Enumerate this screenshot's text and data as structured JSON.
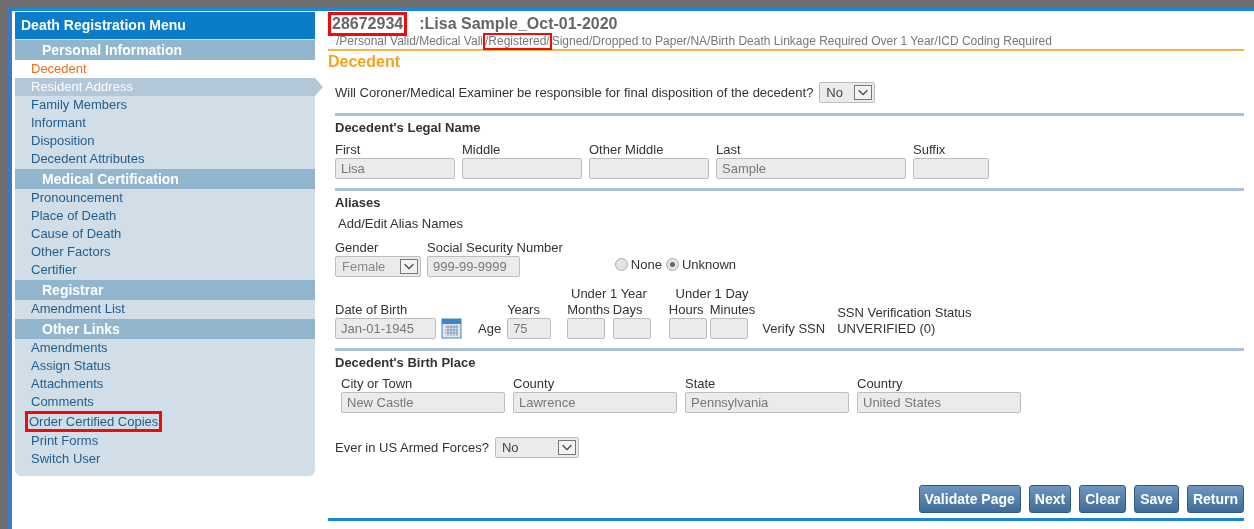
{
  "sidebar": {
    "title": "Death Registration Menu",
    "sections": [
      {
        "title": "Personal Information",
        "items": [
          {
            "label": "Decedent",
            "selected": true,
            "hovered": false,
            "highlighted": false
          },
          {
            "label": "Resident Address",
            "selected": false,
            "hovered": true,
            "highlighted": false
          },
          {
            "label": "Family Members",
            "selected": false,
            "hovered": false,
            "highlighted": false
          },
          {
            "label": "Informant",
            "selected": false,
            "hovered": false,
            "highlighted": false
          },
          {
            "label": "Disposition",
            "selected": false,
            "hovered": false,
            "highlighted": false
          },
          {
            "label": "Decedent Attributes",
            "selected": false,
            "hovered": false,
            "highlighted": false
          }
        ]
      },
      {
        "title": "Medical Certification",
        "items": [
          {
            "label": "Pronouncement",
            "selected": false,
            "hovered": false,
            "highlighted": false
          },
          {
            "label": "Place of Death",
            "selected": false,
            "hovered": false,
            "highlighted": false
          },
          {
            "label": "Cause of Death",
            "selected": false,
            "hovered": false,
            "highlighted": false
          },
          {
            "label": "Other Factors",
            "selected": false,
            "hovered": false,
            "highlighted": false
          },
          {
            "label": "Certifier",
            "selected": false,
            "hovered": false,
            "highlighted": false
          }
        ]
      },
      {
        "title": "Registrar",
        "items": [
          {
            "label": "Amendment List",
            "selected": false,
            "hovered": false,
            "highlighted": false
          }
        ]
      },
      {
        "title": "Other Links",
        "items": [
          {
            "label": "Amendments",
            "selected": false,
            "hovered": false,
            "highlighted": false
          },
          {
            "label": "Assign Status",
            "selected": false,
            "hovered": false,
            "highlighted": false
          },
          {
            "label": "Attachments",
            "selected": false,
            "hovered": false,
            "highlighted": false
          },
          {
            "label": "Comments",
            "selected": false,
            "hovered": false,
            "highlighted": false
          },
          {
            "label": "Order Certified Copies",
            "selected": false,
            "hovered": false,
            "highlighted": true
          },
          {
            "label": "Print Forms",
            "selected": false,
            "hovered": false,
            "highlighted": false
          },
          {
            "label": "Switch User",
            "selected": false,
            "hovered": false,
            "highlighted": false
          }
        ]
      }
    ]
  },
  "record": {
    "id": "28672934",
    "id_highlighted": true,
    "name": ":Lisa Sample_Oct-01-2020",
    "status": [
      {
        "text": "/Personal Valid/Medical Vali",
        "highlighted": false
      },
      {
        "text": "/Registered/",
        "highlighted": true
      },
      {
        "text": "Signed/Dropped to Paper/NA/Birth Death Linkage Required Over 1 Year/ICD Coding Required",
        "highlighted": false
      }
    ]
  },
  "page_title": "Decedent",
  "coroner": {
    "question": "Will Coroner/Medical Examiner be responsible for final disposition of the decedent?",
    "value": "No"
  },
  "legal_name": {
    "title": "Decedent's Legal Name",
    "fields": [
      {
        "label": "First",
        "value": "Lisa"
      },
      {
        "label": "Middle"
      },
      {
        "label": "Other Middle"
      },
      {
        "label": "Last",
        "value": "Sample"
      },
      {
        "label": "Suffix"
      }
    ]
  },
  "aliases": {
    "title": "Aliases",
    "link": "Add/Edit Alias Names",
    "gender": {
      "label": "Gender",
      "value": "Female"
    },
    "ssn": {
      "label": "Social Security Number",
      "value": "999-99-9999"
    },
    "ssn_options": [
      {
        "label": "None",
        "selected": false
      },
      {
        "label": "Unknown",
        "selected": true
      }
    ],
    "dob": {
      "label": "Date of Birth",
      "value": "Jan-01-1945"
    },
    "age_label": "Age",
    "years": {
      "label": "Years",
      "value": "75"
    },
    "under_year": {
      "label": "Under 1 Year",
      "fields": [
        {
          "label": "Months"
        },
        {
          "label": "Days"
        }
      ]
    },
    "under_day": {
      "label": "Under 1 Day",
      "fields": [
        {
          "label": "Hours"
        },
        {
          "label": "Minutes"
        }
      ]
    },
    "verify": "Verify SSN",
    "verification": {
      "label": "SSN Verification Status",
      "value": "UNVERIFIED (0)"
    }
  },
  "birth_place": {
    "title": "Decedent's Birth Place",
    "fields": [
      {
        "label": "City or Town",
        "value": "New Castle"
      },
      {
        "label": "County",
        "value": "Lawrence"
      },
      {
        "label": "State",
        "value": "Pennsylvania"
      },
      {
        "label": "Country",
        "value": "United States"
      }
    ]
  },
  "armed_forces": {
    "question": "Ever in US Armed Forces?",
    "value": "No"
  },
  "buttons": [
    "Validate Page",
    "Next",
    "Clear",
    "Save",
    "Return"
  ]
}
